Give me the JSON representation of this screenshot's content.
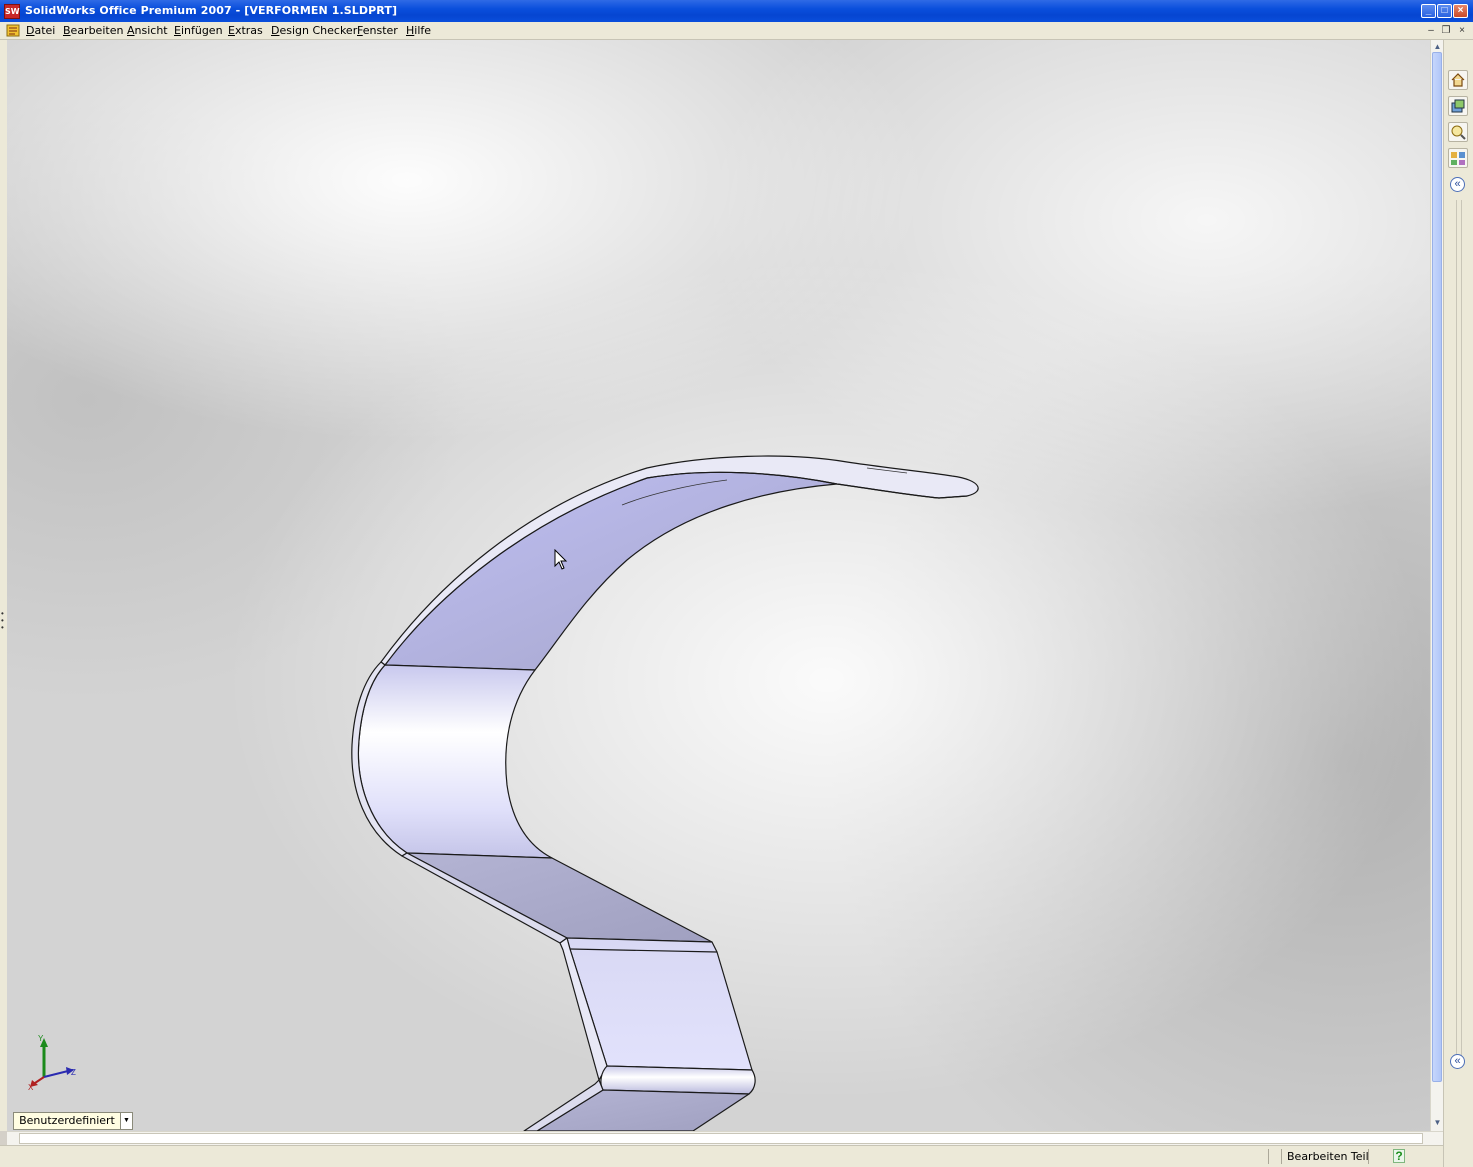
{
  "window": {
    "title": "SolidWorks Office Premium 2007 - [VERFORMEN 1.SLDPRT]",
    "app_icon_text": "SW",
    "minimize_symbol": "_",
    "maximize_symbol": "□",
    "close_symbol": "×"
  },
  "menu": {
    "items": [
      "Datei",
      "Bearbeiten",
      "Ansicht",
      "Einfügen",
      "Extras",
      "Design Checker",
      "Fenster",
      "Hilfe"
    ],
    "doc_minimize": "–",
    "doc_restore": "❐",
    "doc_close": "×"
  },
  "viewport": {
    "view_orientation": "Benutzerdefiniert",
    "triad_axes": {
      "x": "X",
      "y": "Y",
      "z": "Z"
    },
    "model_colors": {
      "face_light": "#e6e6ff",
      "face_mid": "#c0c0e6",
      "face_dark": "#a8a8cc",
      "edge": "#1a1a1a"
    }
  },
  "task_pane": {
    "icons": [
      "home-icon",
      "design-library-icon",
      "file-explorer-icon",
      "view-palette-icon"
    ],
    "collapse_symbol": "«",
    "expand_symbol": "«"
  },
  "status": {
    "mode": "Bearbeiten Teil",
    "help_symbol": "?"
  },
  "colors": {
    "titlebar": "#0a4fdc",
    "menubar": "#ece9d8",
    "accent_green": "#1d8f1d"
  }
}
